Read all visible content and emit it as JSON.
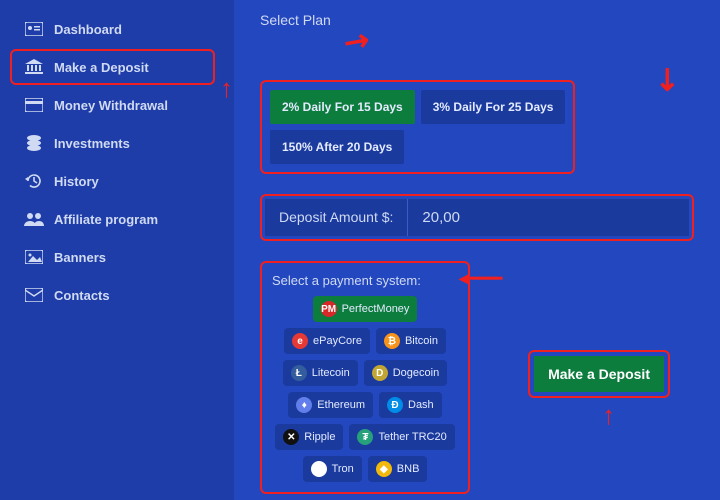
{
  "sidebar": {
    "items": [
      {
        "label": "Dashboard"
      },
      {
        "label": "Make a Deposit"
      },
      {
        "label": "Money Withdrawal"
      },
      {
        "label": "Investments"
      },
      {
        "label": "History"
      },
      {
        "label": "Affiliate program"
      },
      {
        "label": "Banners"
      },
      {
        "label": "Contacts"
      }
    ],
    "active_index": 1
  },
  "main": {
    "select_plan_label": "Select Plan",
    "plans": [
      {
        "label": "2% Daily For 15 Days",
        "active": true
      },
      {
        "label": "3% Daily For 25 Days",
        "active": false
      },
      {
        "label": "150% After 20 Days",
        "active": false
      }
    ],
    "amount_label": "Deposit Amount $:",
    "amount_value": "20,00",
    "pay_label": "Select a payment system:",
    "pay_methods": [
      {
        "label": "PerfectMoney",
        "color": "#d92828",
        "glyph": "PM",
        "active": true
      },
      {
        "label": "ePayCore",
        "color": "#e53935",
        "glyph": "e"
      },
      {
        "label": "Bitcoin",
        "color": "#f7931a",
        "glyph": "₿"
      },
      {
        "label": "Litecoin",
        "color": "#345d9d",
        "glyph": "Ł"
      },
      {
        "label": "Dogecoin",
        "color": "#c2a633",
        "glyph": "D"
      },
      {
        "label": "Ethereum",
        "color": "#627eea",
        "glyph": "♦"
      },
      {
        "label": "Dash",
        "color": "#008ce7",
        "glyph": "Đ"
      },
      {
        "label": "Ripple",
        "color": "#111111",
        "glyph": "✕"
      },
      {
        "label": "Tether TRC20",
        "color": "#26a17b",
        "glyph": "₮"
      },
      {
        "label": "Tron",
        "color": "#ffffff",
        "glyph": " "
      },
      {
        "label": "BNB",
        "color": "#f0b90b",
        "glyph": "◆"
      }
    ],
    "deposit_button": "Make a Deposit"
  }
}
